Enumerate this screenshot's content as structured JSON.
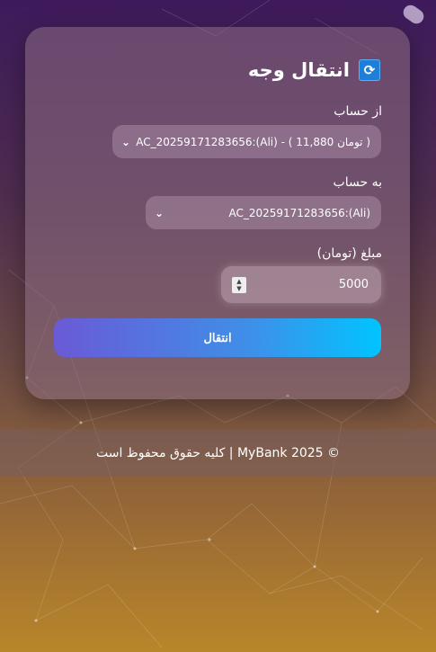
{
  "page": {
    "title": "انتقال وجه"
  },
  "icons": {
    "transfer": "refresh-arrows-icon",
    "dropdown": "chevron-down-icon",
    "spinner": "number-spinner-icon"
  },
  "form": {
    "from_label": "از حساب",
    "from_value": "AC_20259171283656:(Ali) - ( 11,880 تومان )",
    "to_label": "به حساب",
    "to_value": "AC_20259171283656:(Ali)",
    "amount_label": "مبلغ (تومان)",
    "amount_value": "5000",
    "submit_label": "انتقال"
  },
  "footer": {
    "text": "© MyBank 2025 | کلیه حقوق محفوظ است"
  },
  "colors": {
    "accent_start": "#6a5ad6",
    "accent_end": "#00c4ff"
  }
}
